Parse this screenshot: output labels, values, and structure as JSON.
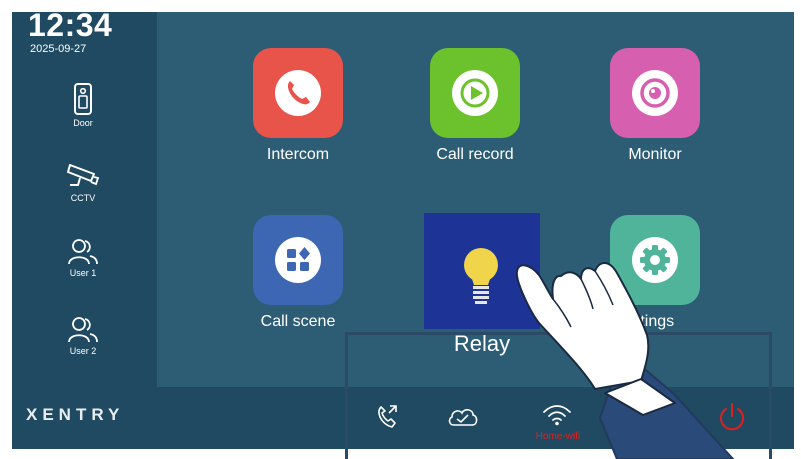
{
  "status": {
    "time": "12:34",
    "date": "2025-09-27"
  },
  "sidebar": {
    "items": [
      {
        "label": "Door",
        "icon": "door-phone-icon"
      },
      {
        "label": "CCTV",
        "icon": "cctv-camera-icon"
      },
      {
        "label": "User 1",
        "icon": "users-icon"
      },
      {
        "label": "User 2",
        "icon": "users-icon"
      }
    ]
  },
  "apps": [
    {
      "label": "Intercom",
      "icon": "phone-icon",
      "color": "#e8534a"
    },
    {
      "label": "Call record",
      "icon": "play-record-icon",
      "color": "#6cc22c"
    },
    {
      "label": "Monitor",
      "icon": "eye-icon",
      "color": "#d65fb0"
    },
    {
      "label": "Call scene",
      "icon": "grid-scene-icon",
      "color": "#3d67b2"
    },
    {
      "label": "Relay",
      "icon": "light-bulb-icon",
      "color": "#1d3396"
    },
    {
      "label": "ttings",
      "icon": "gear-icon",
      "color": "#4fb49a"
    }
  ],
  "bottom_bar": {
    "brand": "XENTRY",
    "wifi_label": "Home-wifi",
    "icons": [
      "call-transfer-icon",
      "cloud-icon",
      "wifi-icon",
      "power-icon"
    ]
  },
  "colors": {
    "background": "#2c5d75",
    "panel": "#1f4a61",
    "warning": "#e02020"
  }
}
